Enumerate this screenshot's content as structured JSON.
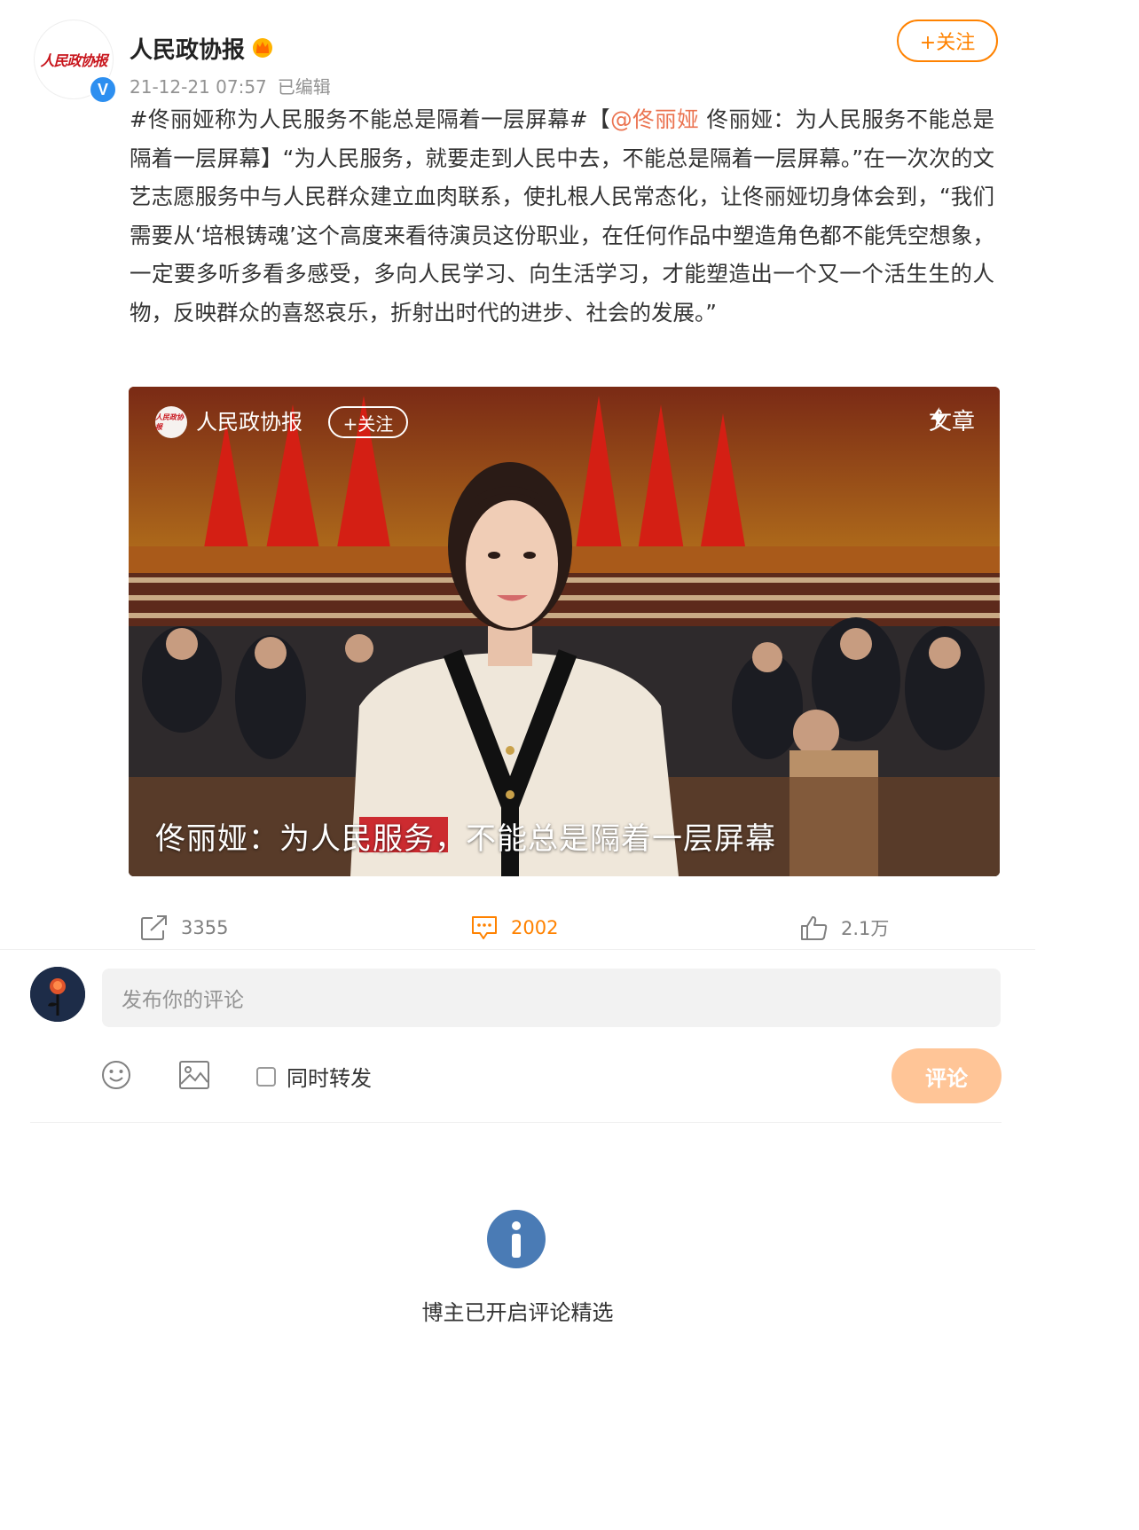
{
  "post": {
    "username": "人民政协报",
    "avatar_logo": "人民政协报",
    "verified_badge": "V",
    "time": "21-12-21 07:57",
    "edited": "已编辑",
    "follow_label": "+关注",
    "text_before_mention": "#佟丽娅称为人民服务不能总是隔着一层屏幕#【",
    "mention": "@佟丽娅",
    "text_after_mention": " 佟丽娅：为人民服务不能总是隔着一层屏幕】“为人民服务，就要走到人民中去，不能总是隔着一层屏幕。”在一次次的文艺志愿服务中与人民群众建立血肉联系，使扎根人民常态化，让佟丽娅切身体会到，“我们需要从‘培根铸魂’这个高度来看待演员这份职业，在任何作品中塑造角色都不能凭空想象，一定要多听多看多感受，多向人民学习、向生活学习，才能塑造出一个又一个活生生的人物，反映群众的喜怒哀乐，折射出时代的进步、社会的发展。”"
  },
  "media": {
    "logo_text": "人民政协报",
    "source_name": "人民政协报",
    "follow_label": "+关注",
    "article_label": "文章",
    "caption": "佟丽娅：为人民服务，不能总是隔着一层屏幕"
  },
  "actions": {
    "repost_count": "3355",
    "comment_count": "2002",
    "like_count": "2.1万"
  },
  "comment_box": {
    "placeholder": "发布你的评论",
    "repost_also_label": "同时转发",
    "submit_label": "评论"
  },
  "notice": "博主已开启评论精选",
  "colors": {
    "accent": "#ff8200",
    "mention": "#eb7350",
    "submit_disabled": "#ffc597",
    "info_icon": "#4a7bb5"
  }
}
